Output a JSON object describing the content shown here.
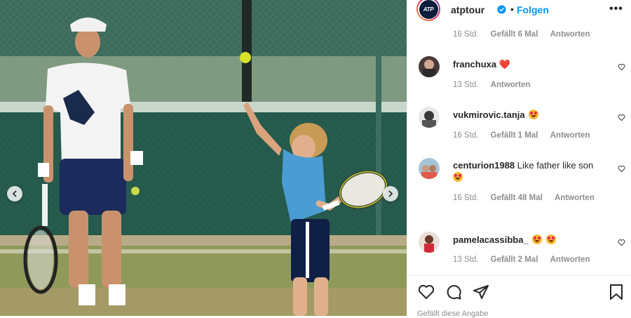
{
  "post": {
    "account": "atptour",
    "avatar_text": "ATP",
    "follow_label": "Folgen",
    "more_label": "•••",
    "dot": "•"
  },
  "top_meta": {
    "time": "16 Std.",
    "likes": "Gefällt 6 Mal",
    "reply": "Antworten"
  },
  "comments": [
    {
      "user": "franchuxa",
      "text": "❤️",
      "time": "13 Std.",
      "likes": "",
      "reply": "Antworten"
    },
    {
      "user": "vukmirovic.tanja",
      "text": "",
      "time": "16 Std.",
      "likes": "Gefällt 1 Mal",
      "reply": "Antworten"
    },
    {
      "user": "centurion1988",
      "text": "Like father like son",
      "time": "16 Std.",
      "likes": "Gefällt 48 Mal",
      "reply": "Antworten"
    },
    {
      "user": "pamelacassibba_",
      "text": "",
      "time": "13 Std.",
      "likes": "Gefällt 2 Mal",
      "reply": "Antworten"
    }
  ],
  "bottom_partial_text": "Gefällt diese Angabe",
  "colors": {
    "link": "#0095f6",
    "text": "#262626",
    "muted": "#8e8e8e",
    "heart": "#ed4956",
    "emoji": "#f7b731"
  },
  "icons": [
    "chevron-left-icon",
    "chevron-right-icon",
    "verified-badge-icon",
    "heart-outline-icon",
    "comment-icon",
    "share-icon",
    "bookmark-icon"
  ]
}
